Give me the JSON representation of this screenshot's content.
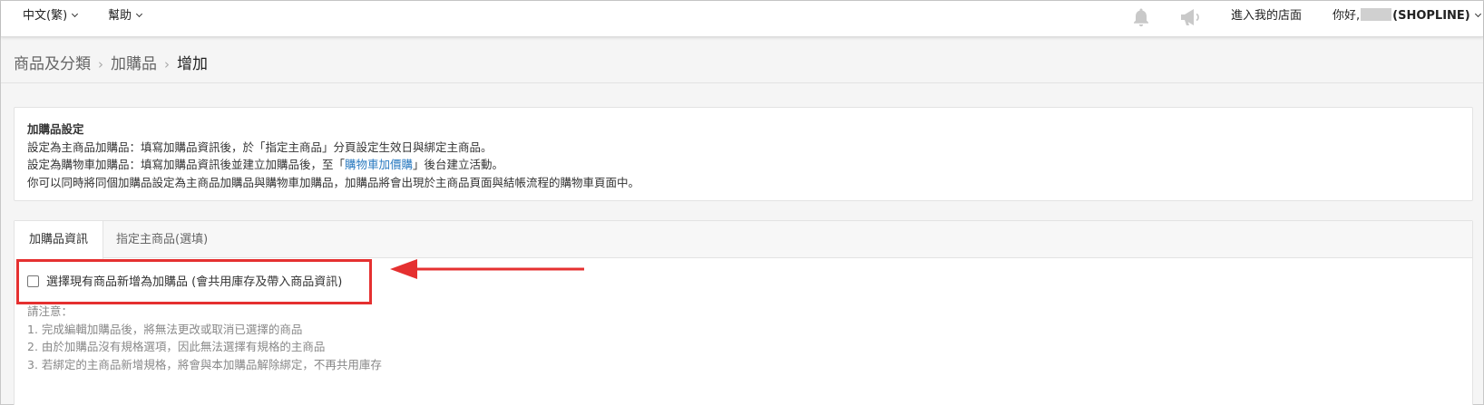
{
  "topbar": {
    "language": "中文(繁)",
    "help": "幫助",
    "bell_icon": "bell-icon",
    "megaphone_icon": "megaphone-icon",
    "store_link": "進入我的店面",
    "greeting": "你好,",
    "brand": "(SHOPLINE)"
  },
  "breadcrumb": {
    "items": [
      "商品及分類",
      "加購品",
      "增加"
    ]
  },
  "info_panel": {
    "title": "加購品設定",
    "line1": "設定為主商品加購品：填寫加購品資訊後，於「指定主商品」分頁設定生效日與綁定主商品。",
    "line2_before": "設定為購物車加購品：填寫加購品資訊後並建立加購品後，至「",
    "line2_link": "購物車加價購",
    "line2_after": "」後台建立活動。",
    "line3": "你可以同時將同個加購品設定為主商品加購品與購物車加購品，加購品將會出現於主商品頁面與結帳流程的購物車頁面中。"
  },
  "tabs": [
    {
      "label": "加購品資訊",
      "active": true
    },
    {
      "label": "指定主商品(選填)",
      "active": false
    }
  ],
  "form": {
    "checkbox_label": "選擇現有商品新增為加購品 (會共用庫存及帶入商品資訊)",
    "checkbox_checked": false,
    "notes_title": "請注意：",
    "notes": [
      "1. 完成編輯加購品後，將無法更改或取消已選擇的商品",
      "2. 由於加購品沒有規格選項，因此無法選擇有規格的主商品",
      "3. 若綁定的主商品新增規格，將會與本加購品解除綁定，不再共用庫存"
    ]
  },
  "colors": {
    "highlight": "#e53030",
    "link": "#2a7ac0"
  }
}
